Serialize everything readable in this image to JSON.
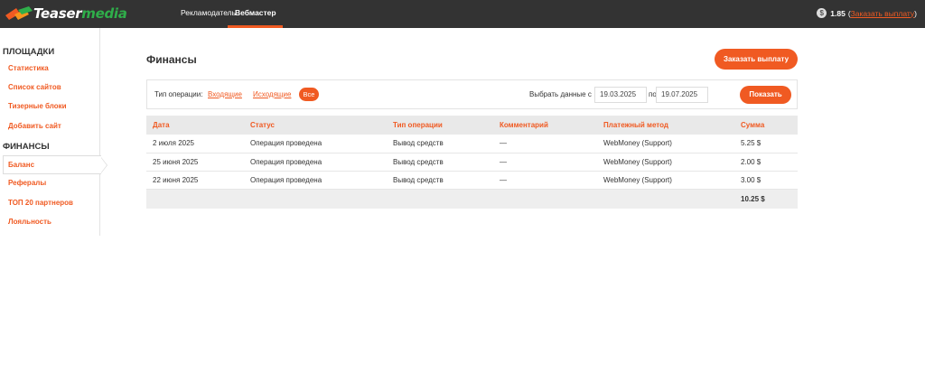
{
  "header": {
    "logo_part1": "Teaser",
    "logo_part2": "media",
    "nav": [
      "Рекламодатель",
      "Вебмастер"
    ],
    "balance_value": "1.85",
    "balance_open_paren": "(",
    "balance_link": "Заказать выплату",
    "balance_close_paren": ")",
    "coin_symbol": "$"
  },
  "sidebar": {
    "section1": "ПЛОЩАДКИ",
    "section1_items": [
      "Статистика",
      "Список сайтов",
      "Тизерные блоки",
      "Добавить сайт"
    ],
    "section2": "ФИНАНСЫ",
    "section2_items": [
      "Баланс",
      "Рефералы",
      "ТОП 20 партнеров",
      "Лояльность"
    ]
  },
  "main": {
    "title": "Финансы",
    "payout_button": "Заказать выплату",
    "filter": {
      "type_label": "Тип операции:",
      "incoming": "Входящие",
      "outgoing": "Исходящие",
      "all": "Все",
      "date_label": "Выбрать данные с",
      "date_from": "19.03.2025",
      "to_label": "по",
      "date_to": "19.07.2025",
      "show_button": "Показать"
    },
    "table": {
      "columns": [
        "Дата",
        "Статус",
        "Тип операции",
        "Комментарий",
        "Платежный метод",
        "Сумма"
      ],
      "rows": [
        [
          "2 июля 2025",
          "Операция проведена",
          "Вывод средств",
          "—",
          "WebMoney (Support)",
          "5.25 $"
        ],
        [
          "25 июня 2025",
          "Операция проведена",
          "Вывод средств",
          "—",
          "WebMoney (Support)",
          "2.00 $"
        ],
        [
          "22 июня 2025",
          "Операция проведена",
          "Вывод средств",
          "—",
          "WebMoney (Support)",
          "3.00 $"
        ]
      ],
      "total": "10.25 $"
    }
  },
  "colors": {
    "accent": "#f05a22",
    "topbar": "#333333",
    "logo_green": "#2fae4a"
  }
}
